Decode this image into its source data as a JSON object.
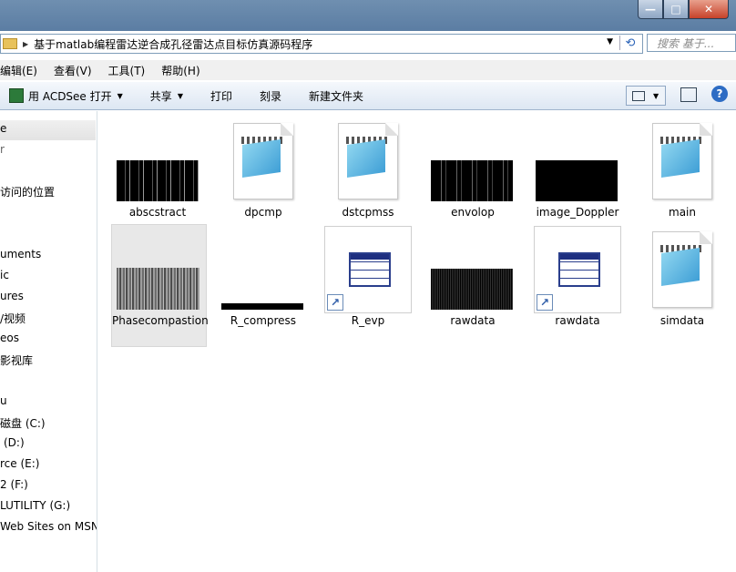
{
  "window": {
    "path": "基于matlab编程雷达逆合成孔径雷达点目标仿真源码程序",
    "search_placeholder": "搜索 基于...",
    "minimize_label": "—",
    "maximize_label": "□",
    "close_label": "✕"
  },
  "menu": [
    "编辑(E)",
    "查看(V)",
    "工具(T)",
    "帮助(H)"
  ],
  "toolbar": {
    "open_with": "用 ACDSee 打开",
    "share": "共享",
    "print": "打印",
    "burn": "刻录",
    "new_folder": "新建文件夹",
    "help": "?"
  },
  "nav": [
    "e",
    "r",
    "访问的位置",
    "uments",
    "ic",
    "ures",
    "/视频",
    "eos",
    "影视库",
    "u",
    "磁盘 (C:)",
    "(D:)",
    "rce (E:)",
    "2 (F:)",
    "LUTILITY (G:)",
    "Web Sites on MSN"
  ],
  "files": [
    {
      "name": "abscstract",
      "icon": "image-thumbnail"
    },
    {
      "name": "dpcmp",
      "icon": "notepad-icon"
    },
    {
      "name": "dstcpmss",
      "icon": "notepad-icon"
    },
    {
      "name": "envolop",
      "icon": "image-thumbnail"
    },
    {
      "name": "image_Doppler",
      "icon": "image-thumbnail"
    },
    {
      "name": "main",
      "icon": "notepad-icon"
    },
    {
      "name": "Phasecompastion",
      "icon": "image-thumbnail"
    },
    {
      "name": "R_compress",
      "icon": "image-thumbnail"
    },
    {
      "name": "R_evp",
      "icon": "table-shortcut-icon"
    },
    {
      "name": "rawdata",
      "icon": "image-thumbnail"
    },
    {
      "name": "rawdata",
      "icon": "table-shortcut-icon"
    },
    {
      "name": "simdata",
      "icon": "notepad-icon"
    }
  ],
  "shortcut_arrow": "↗"
}
